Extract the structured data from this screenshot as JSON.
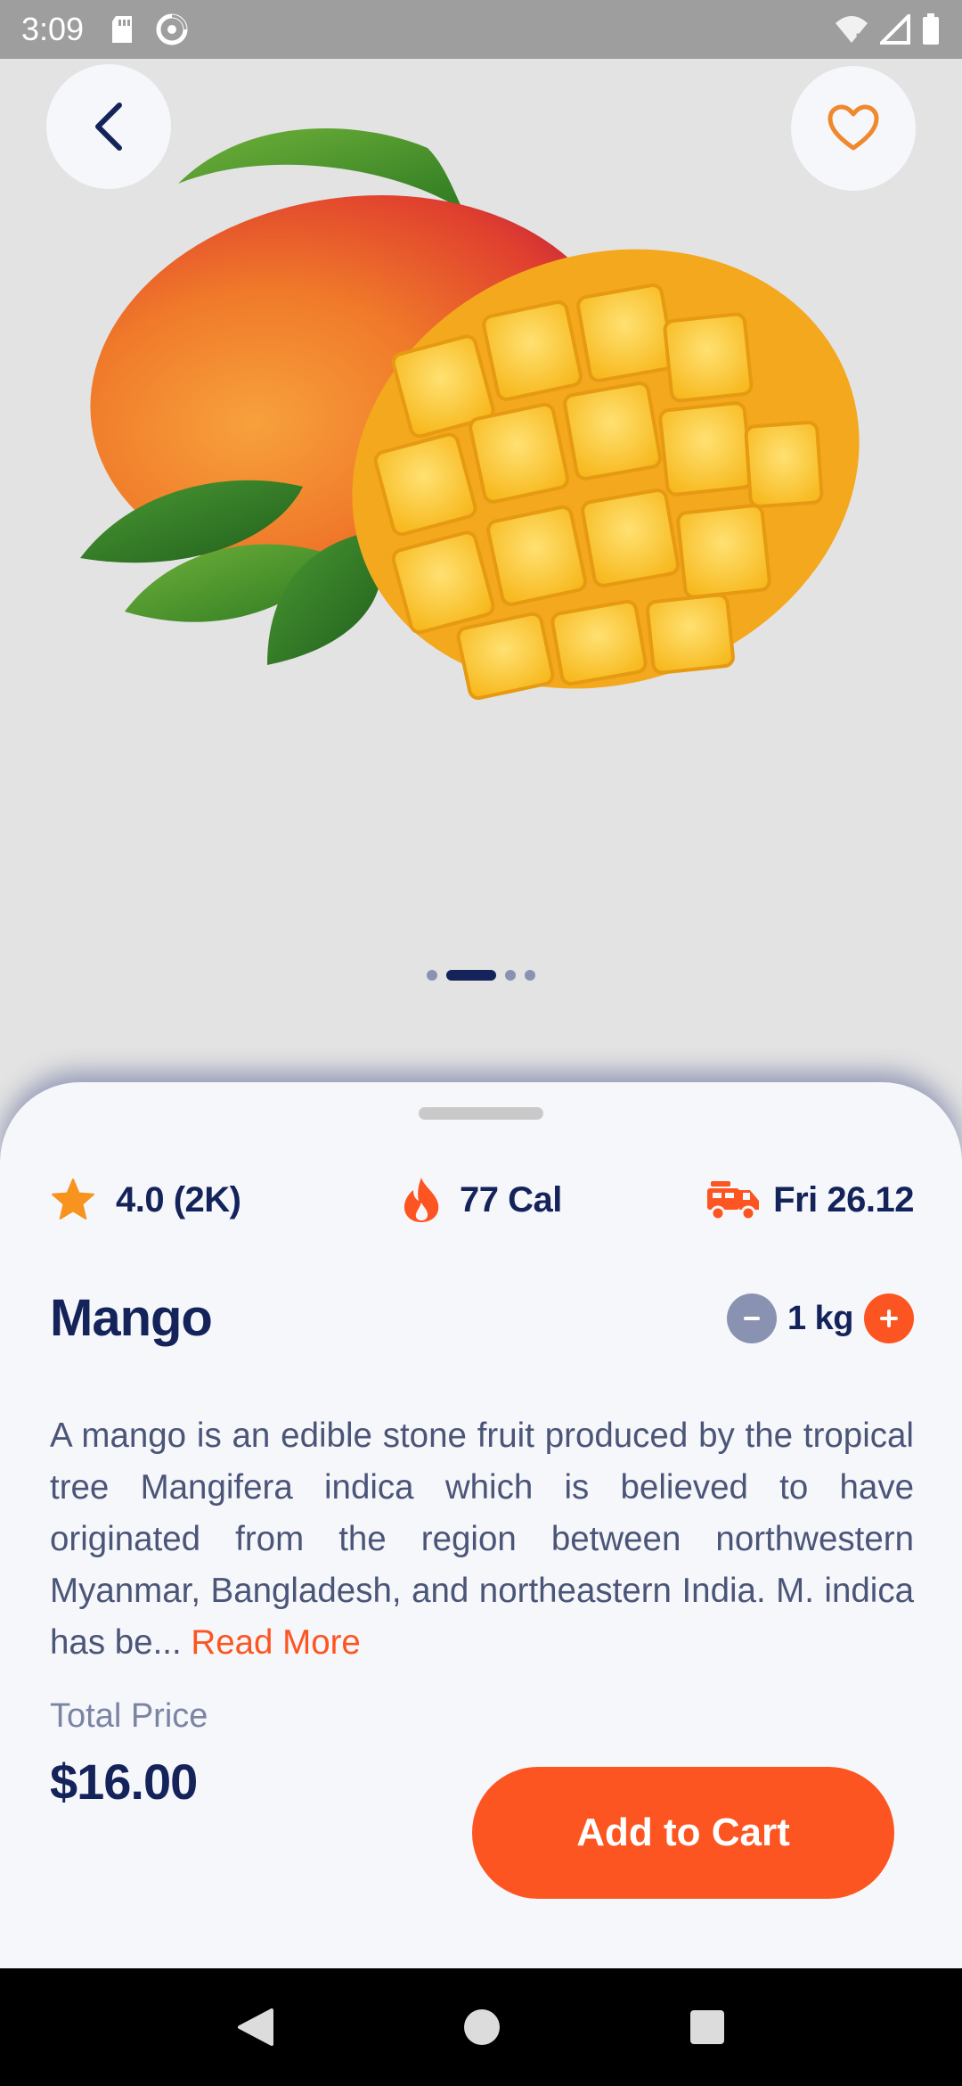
{
  "status_bar": {
    "time": "3:09",
    "icons": [
      "sd-card-icon",
      "data-saver-icon",
      "wifi-icon",
      "signal-icon",
      "battery-icon"
    ]
  },
  "hero": {
    "image": "mango-photo",
    "pager": {
      "count": 4,
      "active_index": 1
    }
  },
  "meta": {
    "rating": "4.0 (2K)",
    "calories": "77 Cal",
    "delivery": "Fri 26.12"
  },
  "product": {
    "name": "Mango",
    "quantity": "1 kg",
    "description": "A mango is an edible stone fruit produced by the tropical tree Mangifera indica which is believed to have originated from the region between northwestern Myanmar, Bangladesh, and northeastern India. M. indica has be...",
    "read_more": "Read More"
  },
  "footer": {
    "total_label": "Total Price",
    "total_value": "$16.00",
    "cart_label": "Add to Cart"
  },
  "colors": {
    "accent": "#fd5521",
    "navy": "#14235a",
    "muted": "#8a92b2",
    "sheet": "#f6f7fb"
  }
}
